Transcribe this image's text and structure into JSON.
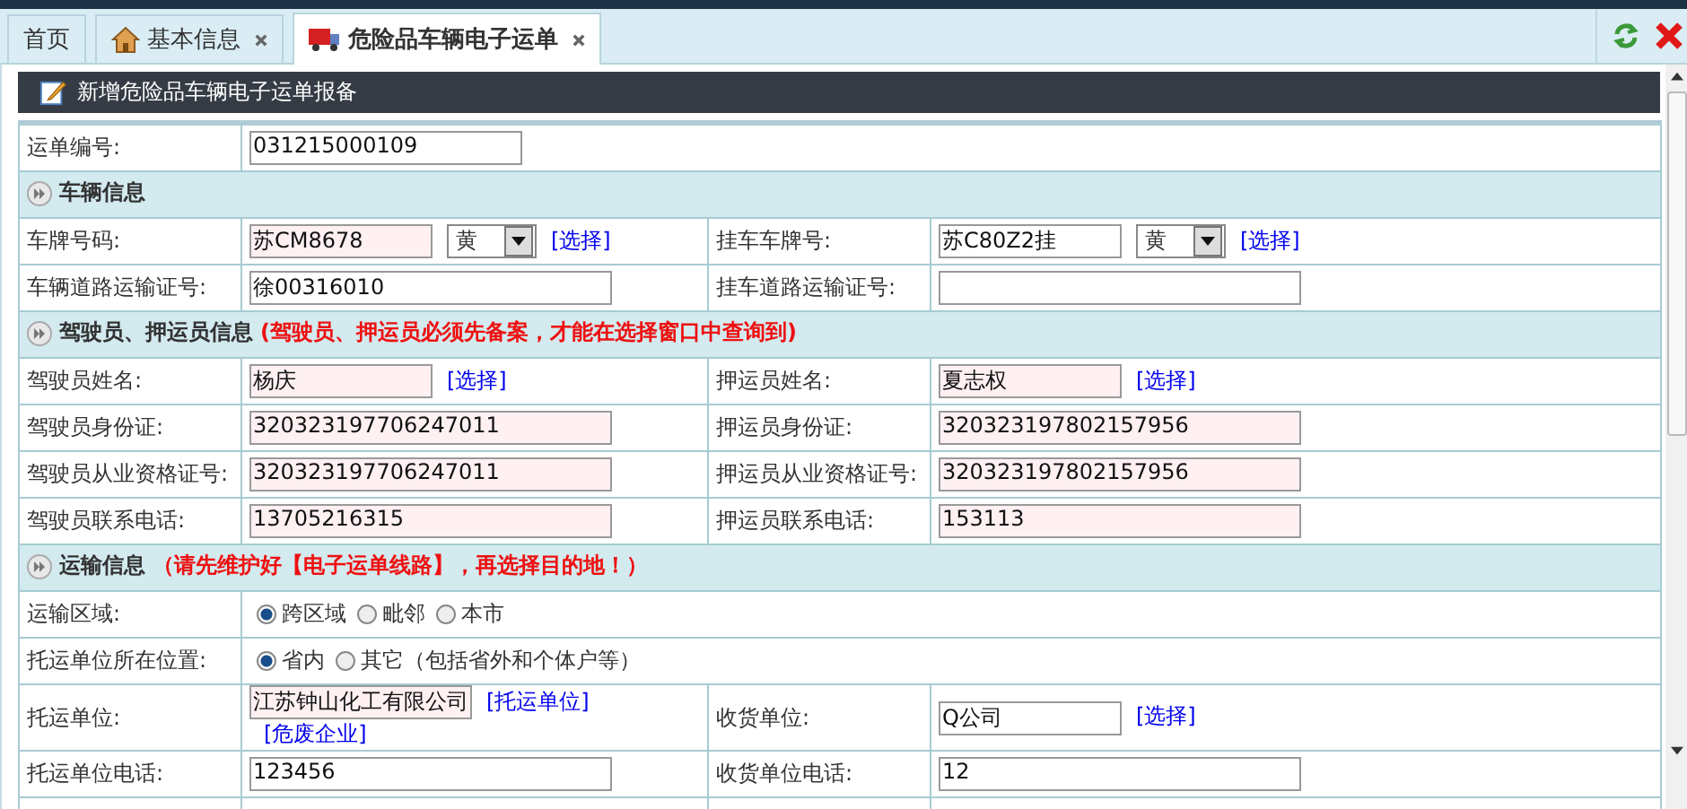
{
  "tabs": [
    {
      "label": "首页",
      "closable": false,
      "selected": false
    },
    {
      "label": "基本信息",
      "closable": true,
      "selected": false
    },
    {
      "label": "危险品车辆电子运单",
      "closable": true,
      "selected": true
    }
  ],
  "panel_title": "新增危险品车辆电子运单报备",
  "rows": [
    {
      "kind": "full",
      "label": "运单编号:",
      "field": {
        "value": "031215000109",
        "required": false
      }
    },
    {
      "kind": "section",
      "title": "车辆信息"
    },
    {
      "kind": "pair",
      "cells": [
        {
          "label": "车牌号码:",
          "field": {
            "value": "苏CM8678",
            "required": true
          },
          "select": "黄",
          "links": [
            "[选择]"
          ]
        },
        {
          "label": "挂车车牌号:",
          "field": {
            "value": "苏C80Z2挂",
            "required": false
          },
          "select": "黄",
          "links": [
            "[选择]"
          ]
        }
      ]
    },
    {
      "kind": "pair",
      "cells": [
        {
          "label": "车辆道路运输证号:",
          "field": {
            "value": "徐00316010",
            "required": false
          }
        },
        {
          "label": "挂车道路运输证号:",
          "field": {
            "required": false
          }
        }
      ]
    },
    {
      "kind": "section",
      "title": "驾驶员、押运员信息",
      "note": "(驾驶员、押运员必须先备案，才能在选择窗口中查询到)"
    },
    {
      "kind": "pair",
      "cells": [
        {
          "label": "驾驶员姓名:",
          "field": {
            "value": "杨庆",
            "required": true
          },
          "links": [
            "[选择]"
          ]
        },
        {
          "label": "押运员姓名:",
          "field": {
            "value": "夏志权",
            "required": true
          },
          "links": [
            "[选择]"
          ]
        }
      ]
    },
    {
      "kind": "pair",
      "cells": [
        {
          "label": "驾驶员身份证:",
          "field": {
            "value": "320323197706247011",
            "required": true
          }
        },
        {
          "label": "押运员身份证:",
          "field": {
            "value": "320323197802157956",
            "required": true
          }
        }
      ]
    },
    {
      "kind": "pair",
      "cells": [
        {
          "label": "驾驶员从业资格证号:",
          "field": {
            "value": "320323197706247011",
            "required": true
          }
        },
        {
          "label": "押运员从业资格证号:",
          "field": {
            "value": "320323197802157956",
            "required": true
          }
        }
      ]
    },
    {
      "kind": "pair",
      "cells": [
        {
          "label": "驾驶员联系电话:",
          "field": {
            "value": "13705216315",
            "required": true
          }
        },
        {
          "label": "押运员联系电话:",
          "field": {
            "value": "153113",
            "required": true
          }
        }
      ]
    },
    {
      "kind": "section",
      "title": "运输信息",
      "note": "（请先维护好【电子运单线路】，再选择目的地！）"
    },
    {
      "kind": "radio",
      "label": "运输区域:",
      "options": [
        {
          "label": "跨区域",
          "selected": true
        },
        {
          "label": "毗邻",
          "selected": false
        },
        {
          "label": "本市",
          "selected": false
        }
      ]
    },
    {
      "kind": "radio",
      "label": "托运单位所在位置:",
      "options": [
        {
          "label": "省内",
          "selected": true
        },
        {
          "label": "其它（包括省外和个体户等）",
          "selected": false
        }
      ]
    },
    {
      "kind": "pair",
      "cells": [
        {
          "label": "托运单位:",
          "field": {
            "value": "江苏钟山化工有限公司",
            "required": true
          },
          "links": [
            "[托运单位]",
            "[危废企业]"
          ]
        },
        {
          "label": "收货单位:",
          "field": {
            "value": "Q公司",
            "required": false
          },
          "links": [
            "[选择]"
          ]
        }
      ]
    },
    {
      "kind": "pair",
      "cells": [
        {
          "label": "托运单位电话:",
          "field": {
            "value": "123456",
            "required": false
          }
        },
        {
          "label": "收货单位电话:",
          "field": {
            "value": "12",
            "required": false
          }
        }
      ]
    }
  ]
}
